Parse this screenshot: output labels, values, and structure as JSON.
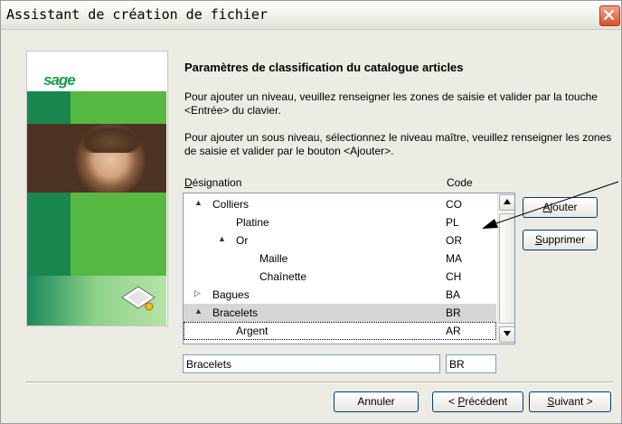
{
  "window": {
    "title": "Assistant de création de fichier"
  },
  "sidebar": {
    "logo": "sage"
  },
  "main": {
    "heading": "Paramètres de classification du catalogue articles",
    "instruction1": "Pour ajouter un niveau, veuillez renseigner les zones de saisie et valider par la touche <Entrée> du clavier.",
    "instruction2": "Pour ajouter un sous niveau, sélectionnez le niveau maître, veuillez renseigner les zones de saisie et valider par le bouton <Ajouter>."
  },
  "tree": {
    "col_designation": "Désignation",
    "col_code": "Code",
    "rows": [
      {
        "label": "Colliers",
        "code": "CO",
        "expand": "▲"
      },
      {
        "label": "Platine",
        "code": "PL"
      },
      {
        "label": "Or",
        "code": "OR",
        "expand": "▲"
      },
      {
        "label": "Maille",
        "code": "MA"
      },
      {
        "label": "Chaînette",
        "code": "CH"
      },
      {
        "label": "Bagues",
        "code": "BA",
        "expand": "▷"
      },
      {
        "label": "Bracelets",
        "code": "BR",
        "expand": "▲"
      },
      {
        "label": "Argent",
        "code": "AR"
      }
    ]
  },
  "fields": {
    "designation_value": "Bracelets",
    "code_value": "BR"
  },
  "buttons": {
    "ajouter": "Ajouter",
    "supprimer": "Supprimer",
    "annuler": "Annuler",
    "precedent": "< Précédent",
    "suivant": "Suivant >"
  },
  "colors": {
    "green_dark": "#19864f",
    "green_light": "#57b842",
    "close_red": "#d8502c"
  },
  "icons": {
    "close": "close-icon",
    "scroll_up": "chevron-up-icon",
    "scroll_down": "chevron-down-icon",
    "card": "card-icon"
  }
}
